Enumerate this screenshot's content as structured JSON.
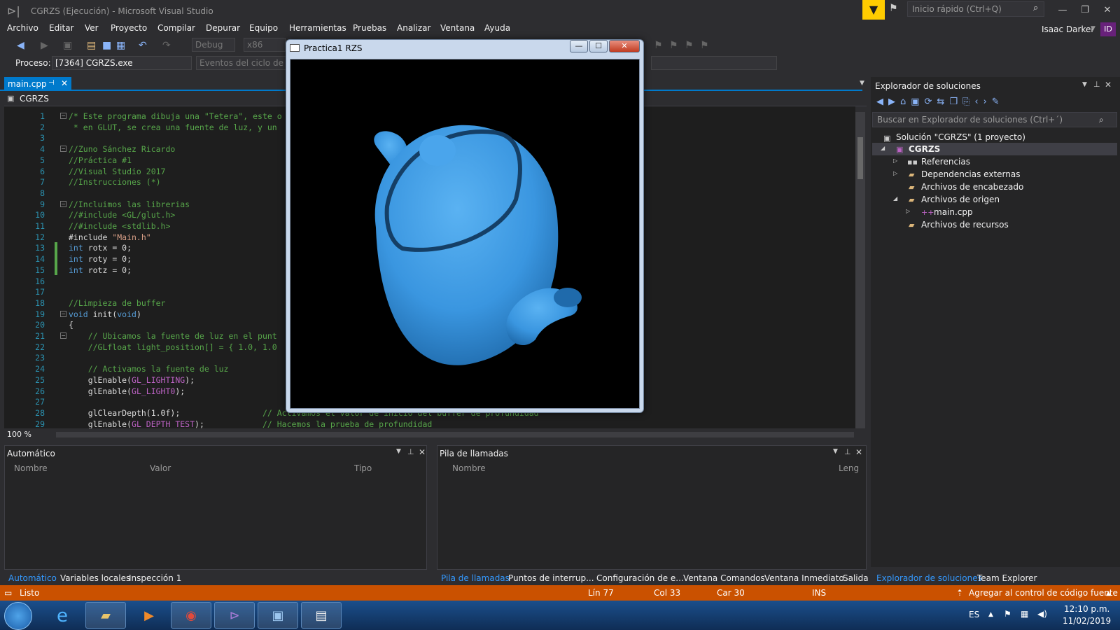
{
  "window": {
    "title": "CGRZS (Ejecución) - Microsoft Visual Studio"
  },
  "quick_launch": {
    "placeholder": "Inicio rápido (Ctrl+Q)"
  },
  "user": {
    "name": "Isaac Darker",
    "initials": "ID"
  },
  "menu": [
    "Archivo",
    "Editar",
    "Ver",
    "Proyecto",
    "Compilar",
    "Depurar",
    "Equipo",
    "Herramientas",
    "Pruebas",
    "Analizar",
    "Ventana",
    "Ayuda"
  ],
  "toolbar": {
    "config": "Debug",
    "platform": "x86"
  },
  "process": {
    "label": "Proceso:",
    "value": "[7364] CGRZS.exe",
    "events": "Eventos del ciclo de"
  },
  "editor": {
    "tab": "main.cpp",
    "project": "CGRZS",
    "zoom": "100 %",
    "lines": [
      {
        "n": "1",
        "t": "/* Este programa dibuja una \"Tetera\", este o",
        "c": "cm"
      },
      {
        "n": "2",
        "t": " * en GLUT, se crea una fuente de luz, y un",
        "c": "cm"
      },
      {
        "n": "3",
        "t": "",
        "c": ""
      },
      {
        "n": "4",
        "t": "//Zuno Sánchez Ricardo",
        "c": "cm"
      },
      {
        "n": "5",
        "t": "//Práctica #1",
        "c": "cm"
      },
      {
        "n": "6",
        "t": "//Visual Studio 2017",
        "c": "cm"
      },
      {
        "n": "7",
        "t": "//Instrucciones (*)",
        "c": "cm"
      },
      {
        "n": "8",
        "t": "",
        "c": ""
      },
      {
        "n": "9",
        "t": "//Incluimos las librerias",
        "c": "cm"
      },
      {
        "n": "10",
        "t": "//#include <GL/glut.h>",
        "c": "cm"
      },
      {
        "n": "11",
        "t": "//#include <stdlib.h>",
        "c": "cm"
      },
      {
        "n": "12",
        "t": "#include \"Main.h\"",
        "c": "inc"
      },
      {
        "n": "13",
        "t": "int rotx = 0;",
        "c": "int"
      },
      {
        "n": "14",
        "t": "int roty = 0;",
        "c": "int"
      },
      {
        "n": "15",
        "t": "int rotz = 0;",
        "c": "int"
      },
      {
        "n": "16",
        "t": "",
        "c": ""
      },
      {
        "n": "17",
        "t": "",
        "c": ""
      },
      {
        "n": "18",
        "t": "//Limpieza de buffer",
        "c": "cm"
      },
      {
        "n": "19",
        "t": "void init(void)",
        "c": "void"
      },
      {
        "n": "20",
        "t": "{",
        "c": ""
      },
      {
        "n": "21",
        "t": "    // Ubicamos la fuente de luz en el punt",
        "c": "cm"
      },
      {
        "n": "22",
        "t": "    //GLfloat light_position[] = { 1.0, 1.0",
        "c": "cm"
      },
      {
        "n": "23",
        "t": "",
        "c": ""
      },
      {
        "n": "24",
        "t": "    // Activamos la fuente de luz",
        "c": "cm"
      },
      {
        "n": "25",
        "t": "    glEnable(GL_LIGHTING);",
        "c": "gl"
      },
      {
        "n": "26",
        "t": "    glEnable(GL_LIGHT0);",
        "c": "gl"
      },
      {
        "n": "27",
        "t": "",
        "c": ""
      },
      {
        "n": "28",
        "t": "    glClearDepth(1.0f);                 // Activamos el valor de inicio del buffer de profundidad",
        "c": "mix"
      },
      {
        "n": "29",
        "t": "    glEnable(GL_DEPTH_TEST);            // Hacemos la prueba de profundidad",
        "c": "mix"
      }
    ]
  },
  "auto_panel": {
    "title": "Automático",
    "cols": [
      "Nombre",
      "Valor",
      "Tipo"
    ],
    "tabs": [
      "Automático",
      "Variables locales",
      "Inspección 1"
    ]
  },
  "stack_panel": {
    "title": "Pila de llamadas",
    "cols": [
      "Nombre",
      "Leng"
    ],
    "tabs": [
      "Pila de llamadas",
      "Puntos de interrup...",
      "Configuración de e...",
      "Ventana Comandos",
      "Ventana Inmediato",
      "Salida"
    ]
  },
  "solution": {
    "title": "Explorador de soluciones",
    "search": "Buscar en Explorador de soluciones (Ctrl+´)",
    "items": [
      "Solución \"CGRZS\" (1 proyecto)",
      "CGRZS",
      "Referencias",
      "Dependencias externas",
      "Archivos de encabezado",
      "Archivos de origen",
      "main.cpp",
      "Archivos de recursos"
    ],
    "tabs": [
      "Explorador de soluciones",
      "Team Explorer"
    ]
  },
  "status": {
    "ready": "Listo",
    "line": "Lín 77",
    "col": "Col 33",
    "car": "Car 30",
    "mode": "INS",
    "source": "Agregar al control de código fuente"
  },
  "gl_window": {
    "title": "Practica1 RZS",
    "teapot_color": "#3a96e0"
  },
  "taskbar": {
    "lang": "ES",
    "time": "12:10 p.m.",
    "date": "11/02/2019"
  },
  "colors": {
    "accent": "#007acc",
    "status": "#ca5100"
  }
}
